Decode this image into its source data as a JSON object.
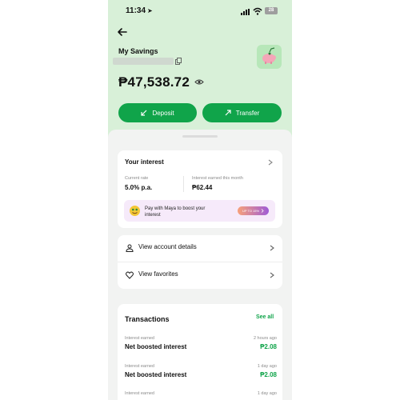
{
  "status_bar": {
    "time": "11:34",
    "battery": "28"
  },
  "header": {
    "title": "My Savings",
    "balance": "₱47,538.72"
  },
  "actions": {
    "deposit_label": "Deposit",
    "transfer_label": "Transfer"
  },
  "interest_card": {
    "title": "Your interest",
    "rate_label": "Current rate",
    "rate_value": "5.0% p.a.",
    "earned_label": "Interest earned this month",
    "earned_value": "₱62.44",
    "promo_text": "Pay with Maya to boost your interest",
    "promo_pill": "UP TO 15%"
  },
  "menu": [
    {
      "label": "View account details",
      "icon": "person-icon"
    },
    {
      "label": "View favorites",
      "icon": "heart-icon"
    }
  ],
  "transactions": {
    "title": "Transactions",
    "see_all": "See all",
    "items": [
      {
        "category": "Interest earned",
        "name": "Net boosted interest",
        "time": "2 hours ago",
        "amount": "₱2.08"
      },
      {
        "category": "Interest earned",
        "name": "Net boosted interest",
        "time": "1 day ago",
        "amount": "₱2.08"
      },
      {
        "category": "Interest earned",
        "name": "",
        "time": "1 day ago",
        "amount": ""
      }
    ]
  },
  "colors": {
    "accent": "#10a44a",
    "header_bg": "#d8f0d8",
    "promo_bg": "#f6eafa"
  }
}
